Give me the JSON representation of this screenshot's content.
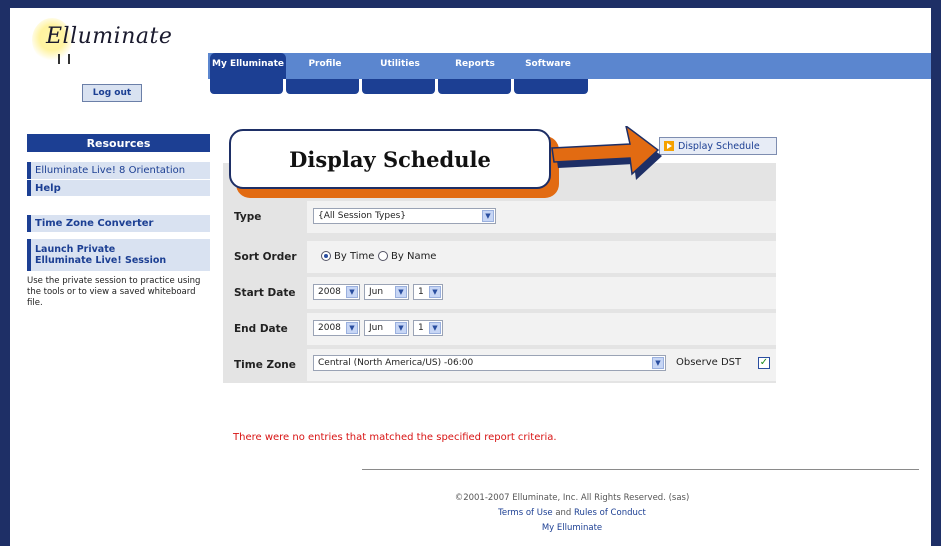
{
  "app": {
    "logo_text": "Elluminate"
  },
  "nav": {
    "tabs": [
      {
        "label": "My Elluminate",
        "active": true
      },
      {
        "label": "Profile"
      },
      {
        "label": "Utilities"
      },
      {
        "label": "Reports"
      },
      {
        "label": "Software"
      }
    ],
    "logout_label": "Log out"
  },
  "sidebar": {
    "header": "Resources",
    "items": [
      {
        "label": "Elluminate Live! 8 Orientation"
      },
      {
        "label": "Help"
      },
      {
        "label": "Time Zone Converter"
      },
      {
        "label": "Launch Private Elluminate Live! Session"
      }
    ],
    "description": "Use the private session to practice using the tools or to view a saved whiteboard file."
  },
  "callout": {
    "text": "Display Schedule"
  },
  "form": {
    "display_button": "Display Schedule",
    "type": {
      "label": "Type",
      "value": "{All Session Types}"
    },
    "sort": {
      "label": "Sort Order",
      "option1": "By Time",
      "option2": "By Name",
      "selected": "By Time"
    },
    "start": {
      "label": "Start Date",
      "year": "2008",
      "month": "Jun",
      "day": "1"
    },
    "end": {
      "label": "End Date",
      "year": "2008",
      "month": "Jun",
      "day": "1"
    },
    "timezone": {
      "label": "Time Zone",
      "value": "Central (North America/US) -06:00",
      "dst_label": "Observe DST",
      "dst_checked": true
    }
  },
  "message": "There were no entries that matched the specified report criteria.",
  "footer": {
    "copyright": "©2001-2007 Elluminate, Inc. All Rights Reserved. (sas)",
    "terms": "Terms of Use",
    "and": "and",
    "rules": "Rules of Conduct",
    "my_elluminate": "My Elluminate"
  },
  "colors": {
    "nav_dark": "#1c3f93",
    "nav_light": "#5b86cf",
    "frame": "#1e2f66",
    "callout_accent": "#e26b12",
    "error": "#d81414"
  }
}
